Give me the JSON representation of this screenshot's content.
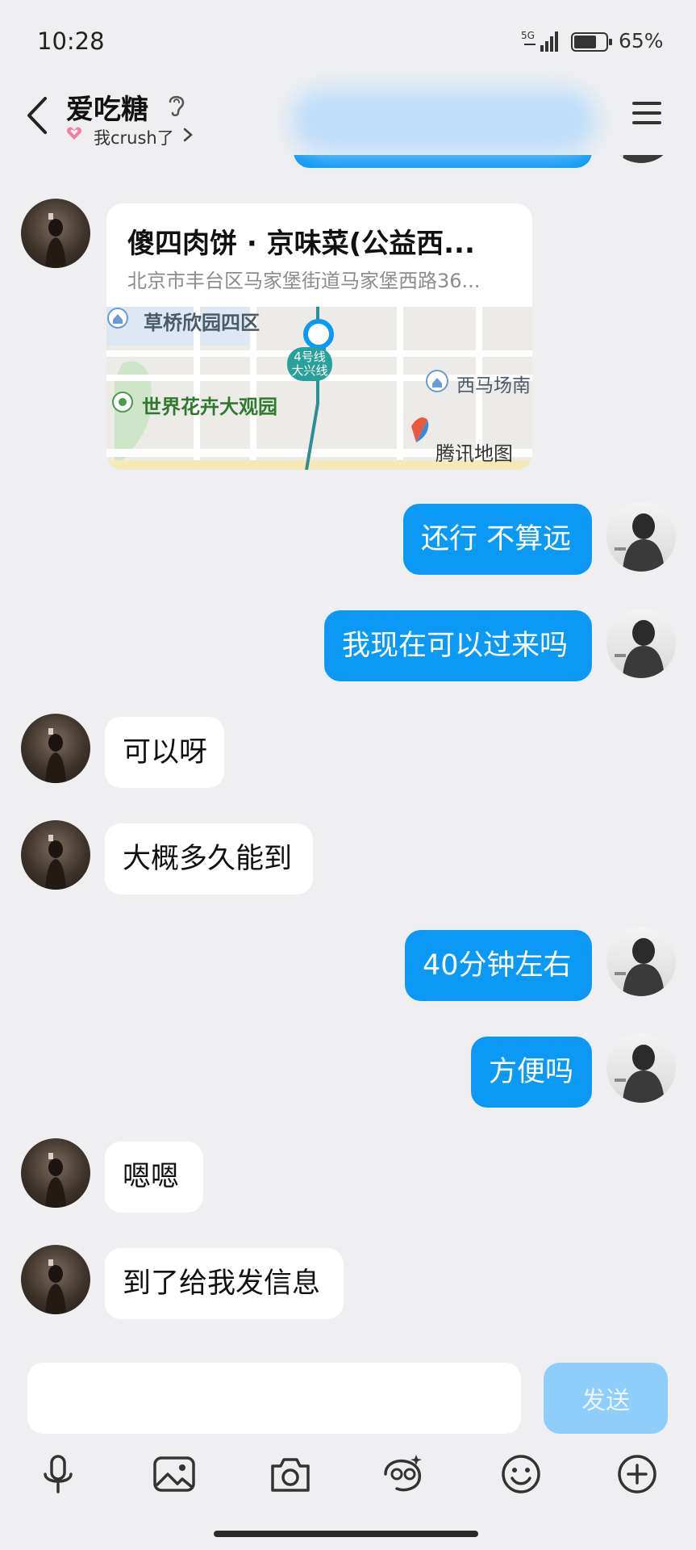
{
  "status": {
    "time": "10:28",
    "network": "5G",
    "battery": "65%"
  },
  "header": {
    "title": "爱吃糖",
    "subtitle": "我crush了"
  },
  "location_card": {
    "name": "傻四肉饼 · 京味菜(公益西...",
    "address": "北京市丰台区马家堡街道马家堡西路36...",
    "map_labels": {
      "area1": "草桥欣园四区",
      "park": "世界花卉大观园",
      "area2": "西马场南",
      "metro": "4号线 大兴线",
      "provider": "腾讯地图"
    }
  },
  "messages": [
    {
      "side": "out",
      "text": "还行 不算远"
    },
    {
      "side": "out",
      "text": "我现在可以过来吗"
    },
    {
      "side": "in",
      "text": "可以呀"
    },
    {
      "side": "in",
      "text": "大概多久能到"
    },
    {
      "side": "out",
      "text": "40分钟左右"
    },
    {
      "side": "out",
      "text": "方便吗"
    },
    {
      "side": "in",
      "text": "嗯嗯"
    },
    {
      "side": "in",
      "text": "到了给我发信息"
    }
  ],
  "input": {
    "placeholder": "",
    "send_label": "发送"
  },
  "toolbar": [
    "mic-icon",
    "image-icon",
    "camera-icon",
    "red-envelope-icon",
    "emoji-icon",
    "plus-icon"
  ],
  "colors": {
    "accent": "#0c99f5",
    "send_disabled": "#8fcdfa",
    "background": "#efeff1"
  }
}
